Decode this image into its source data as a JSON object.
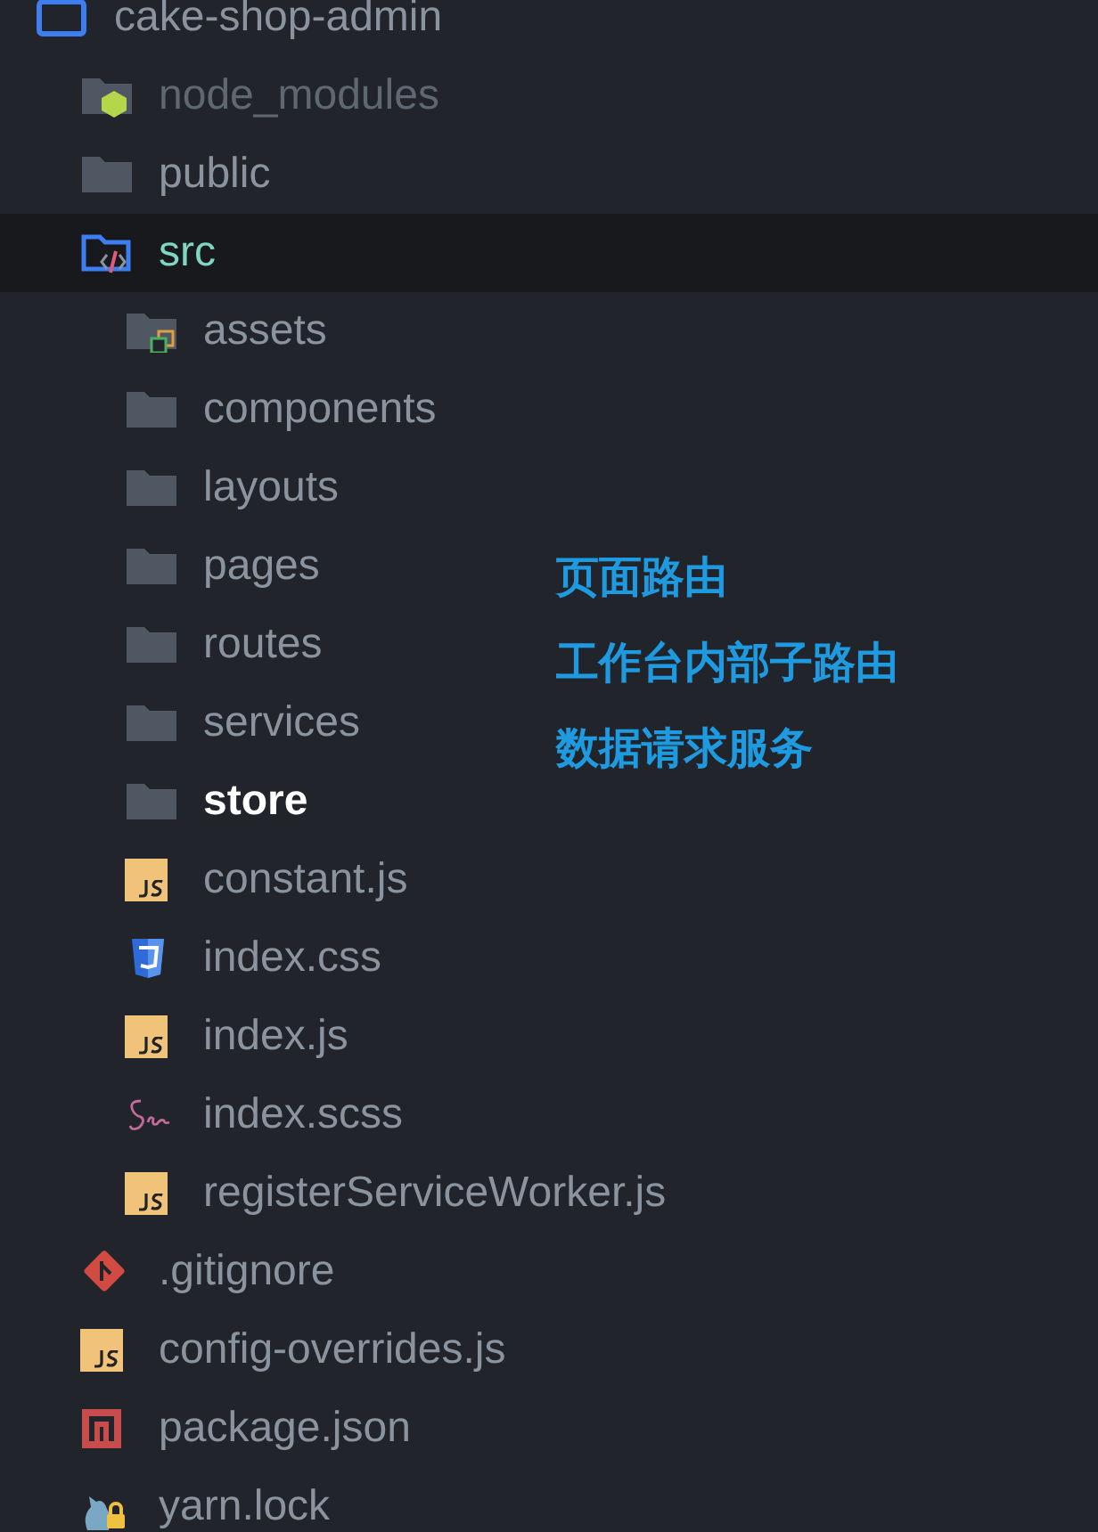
{
  "tree": {
    "label": "cake-shop-admin",
    "kind": "root",
    "selected": false,
    "ignored": false,
    "active": false,
    "children": [
      {
        "label": "node_modules",
        "kind": "node-folder",
        "selected": false,
        "ignored": true,
        "active": false
      },
      {
        "label": "public",
        "kind": "folder",
        "selected": false,
        "ignored": false,
        "active": false
      },
      {
        "label": "src",
        "kind": "src-folder",
        "selected": true,
        "ignored": false,
        "active": false,
        "children": [
          {
            "label": "assets",
            "kind": "assets-folder",
            "selected": false,
            "ignored": false,
            "active": false
          },
          {
            "label": "components",
            "kind": "folder",
            "selected": false,
            "ignored": false,
            "active": false
          },
          {
            "label": "layouts",
            "kind": "folder",
            "selected": false,
            "ignored": false,
            "active": false
          },
          {
            "label": "pages",
            "kind": "folder",
            "selected": false,
            "ignored": false,
            "active": false
          },
          {
            "label": "routes",
            "kind": "folder",
            "selected": false,
            "ignored": false,
            "active": false
          },
          {
            "label": "services",
            "kind": "folder",
            "selected": false,
            "ignored": false,
            "active": false
          },
          {
            "label": "store",
            "kind": "folder",
            "selected": false,
            "ignored": false,
            "active": true
          },
          {
            "label": "constant.js",
            "kind": "js",
            "selected": false,
            "ignored": false,
            "active": false
          },
          {
            "label": "index.css",
            "kind": "css",
            "selected": false,
            "ignored": false,
            "active": false
          },
          {
            "label": "index.js",
            "kind": "js",
            "selected": false,
            "ignored": false,
            "active": false
          },
          {
            "label": "index.scss",
            "kind": "sass",
            "selected": false,
            "ignored": false,
            "active": false
          },
          {
            "label": "registerServiceWorker.js",
            "kind": "js",
            "selected": false,
            "ignored": false,
            "active": false
          }
        ]
      },
      {
        "label": ".gitignore",
        "kind": "git",
        "selected": false,
        "ignored": false,
        "active": false
      },
      {
        "label": "config-overrides.js",
        "kind": "js",
        "selected": false,
        "ignored": false,
        "active": false
      },
      {
        "label": "package.json",
        "kind": "npm",
        "selected": false,
        "ignored": false,
        "active": false
      },
      {
        "label": "yarn.lock",
        "kind": "yarn",
        "selected": false,
        "ignored": false,
        "active": false
      }
    ]
  },
  "annotations": [
    "页面路由",
    "工作台内部子路由",
    "数据请求服务"
  ]
}
